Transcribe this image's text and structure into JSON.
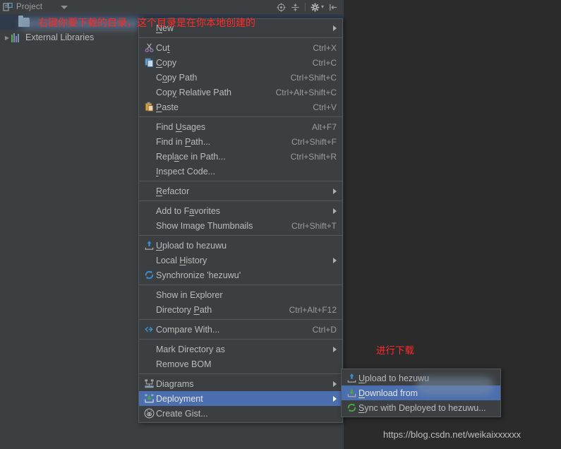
{
  "window": {
    "background_color": "#2b2b2b",
    "panel_color": "#3c3f41",
    "accent_color": "#4b6eaf",
    "annotation_color": "#ff2a2a"
  },
  "panel": {
    "title": "Project",
    "icon": "project-structure-icon",
    "toolbar_buttons": [
      {
        "name": "locate-icon",
        "glyph": "⊕"
      },
      {
        "name": "collapse-all-icon",
        "glyph": "ⷠ"
      },
      {
        "name": "settings-gear-icon",
        "glyph": "⚙"
      },
      {
        "name": "hide-panel-icon",
        "glyph": "⇥"
      }
    ]
  },
  "tree": {
    "items": [
      {
        "label": "",
        "icon": "folder-icon",
        "redacted": true,
        "selected": true,
        "indent": 1
      },
      {
        "label": "External Libraries",
        "icon": "library-icon",
        "redacted": false,
        "selected": false,
        "indent": 0
      }
    ]
  },
  "context_menu": {
    "name": "project-context-menu",
    "groups": [
      {
        "items": [
          {
            "label": "New",
            "mnemonic": "N",
            "shortcut": "",
            "submenu": true,
            "icon": ""
          }
        ]
      },
      {
        "items": [
          {
            "label": "Cut",
            "mnemonic": "t",
            "shortcut": "Ctrl+X",
            "submenu": false,
            "icon": "scissors-icon"
          },
          {
            "label": "Copy",
            "mnemonic": "C",
            "shortcut": "Ctrl+C",
            "submenu": false,
            "icon": "copy-icon"
          },
          {
            "label": "Copy Path",
            "mnemonic": "o",
            "shortcut": "Ctrl+Shift+C",
            "submenu": false,
            "icon": ""
          },
          {
            "label": "Copy Relative Path",
            "mnemonic": "y",
            "shortcut": "Ctrl+Alt+Shift+C",
            "submenu": false,
            "icon": ""
          },
          {
            "label": "Paste",
            "mnemonic": "P",
            "shortcut": "Ctrl+V",
            "submenu": false,
            "icon": "paste-icon"
          }
        ]
      },
      {
        "items": [
          {
            "label": "Find Usages",
            "mnemonic": "U",
            "shortcut": "Alt+F7",
            "submenu": false,
            "icon": ""
          },
          {
            "label": "Find in Path...",
            "mnemonic": "P",
            "shortcut": "Ctrl+Shift+F",
            "submenu": false,
            "icon": ""
          },
          {
            "label": "Replace in Path...",
            "mnemonic": "a",
            "shortcut": "Ctrl+Shift+R",
            "submenu": false,
            "icon": ""
          },
          {
            "label": "Inspect Code...",
            "mnemonic": "I",
            "shortcut": "",
            "submenu": false,
            "icon": ""
          }
        ]
      },
      {
        "items": [
          {
            "label": "Refactor",
            "mnemonic": "R",
            "shortcut": "",
            "submenu": true,
            "icon": ""
          }
        ]
      },
      {
        "items": [
          {
            "label": "Add to Favorites",
            "mnemonic": "a",
            "shortcut": "",
            "submenu": true,
            "icon": ""
          },
          {
            "label": "Show Image Thumbnails",
            "mnemonic": "",
            "shortcut": "Ctrl+Shift+T",
            "submenu": false,
            "icon": ""
          }
        ]
      },
      {
        "items": [
          {
            "label": "Upload to hezuwu",
            "mnemonic": "U",
            "shortcut": "",
            "submenu": false,
            "icon": "upload-icon"
          },
          {
            "label": "Local History",
            "mnemonic": "H",
            "shortcut": "",
            "submenu": true,
            "icon": ""
          },
          {
            "label": "Synchronize 'hezuwu'",
            "mnemonic": "",
            "shortcut": "",
            "submenu": false,
            "icon": "synchronize-icon"
          }
        ]
      },
      {
        "items": [
          {
            "label": "Show in Explorer",
            "mnemonic": "",
            "shortcut": "",
            "submenu": false,
            "icon": ""
          },
          {
            "label": "Directory Path",
            "mnemonic": "P",
            "shortcut": "Ctrl+Alt+F12",
            "submenu": false,
            "icon": ""
          }
        ]
      },
      {
        "items": [
          {
            "label": "Compare With...",
            "mnemonic": "",
            "shortcut": "Ctrl+D",
            "submenu": false,
            "icon": "compare-icon"
          }
        ]
      },
      {
        "items": [
          {
            "label": "Mark Directory as",
            "mnemonic": "",
            "shortcut": "",
            "submenu": true,
            "icon": ""
          },
          {
            "label": "Remove BOM",
            "mnemonic": "",
            "shortcut": "",
            "submenu": false,
            "icon": ""
          }
        ]
      },
      {
        "items": [
          {
            "label": "Diagrams",
            "mnemonic": "",
            "shortcut": "",
            "submenu": true,
            "icon": "diagram-icon"
          },
          {
            "label": "Deployment",
            "mnemonic": "",
            "shortcut": "",
            "submenu": true,
            "icon": "deployment-icon",
            "selected": true
          },
          {
            "label": "Create Gist...",
            "mnemonic": "",
            "shortcut": "",
            "submenu": false,
            "icon": "github-icon"
          }
        ]
      }
    ]
  },
  "submenu": {
    "name": "deployment-submenu",
    "items": [
      {
        "label": "Upload to hezuwu",
        "mnemonic": "U",
        "icon": "upload-icon",
        "selected": false,
        "redacted": false
      },
      {
        "label": "Download from",
        "mnemonic": "D",
        "icon": "download-icon",
        "selected": true,
        "redacted": true
      },
      {
        "label": "Sync with Deployed to hezuwu...",
        "mnemonic": "S",
        "icon": "sync-icon",
        "selected": false,
        "redacted": false
      }
    ]
  },
  "annotations": [
    {
      "name": "annotation-right-click-hint",
      "text": "右键你要下载的目录，这个目录是在你本地创建的"
    },
    {
      "name": "annotation-download-hint",
      "text": "进行下载"
    }
  ],
  "watermark": {
    "text": "https://blog.csdn.net/weikaixxxxxx"
  }
}
